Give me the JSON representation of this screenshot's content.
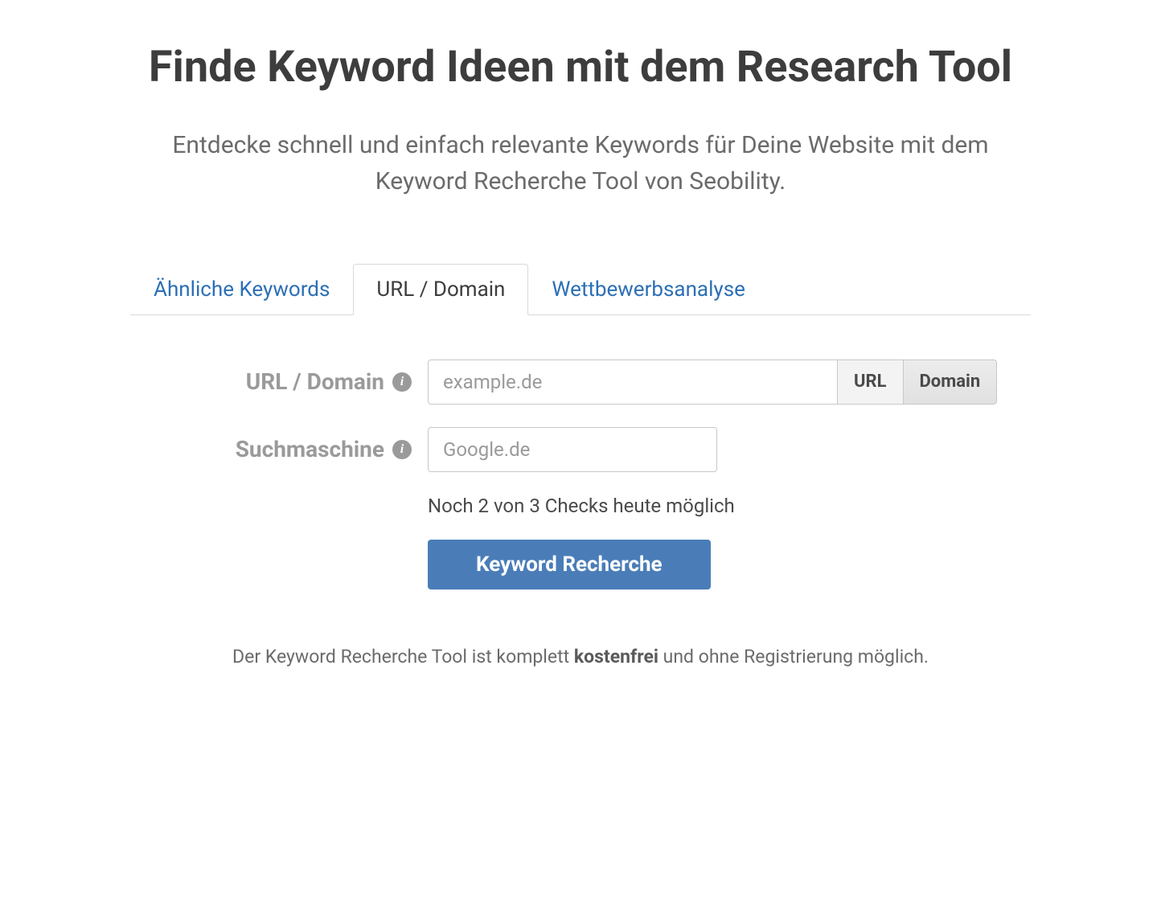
{
  "header": {
    "title": "Finde Keyword Ideen mit dem Research Tool",
    "subtitle": "Entdecke schnell und einfach relevante Keywords für Deine Website mit dem Keyword Recherche Tool von Seobility."
  },
  "tabs": {
    "similar": "Ähnliche Keywords",
    "urldomain": "URL / Domain",
    "competitor": "Wettbewerbsanalyse"
  },
  "form": {
    "url_label": "URL / Domain",
    "url_placeholder": "example.de",
    "url_toggle_url": "URL",
    "url_toggle_domain": "Domain",
    "engine_label": "Suchmaschine",
    "engine_placeholder": "Google.de",
    "status": "Noch 2 von 3 Checks heute möglich",
    "submit": "Keyword Recherche"
  },
  "footer": {
    "prefix": "Der Keyword Recherche Tool ist komplett ",
    "bold": "kostenfrei",
    "suffix": " und ohne Registrierung möglich."
  }
}
